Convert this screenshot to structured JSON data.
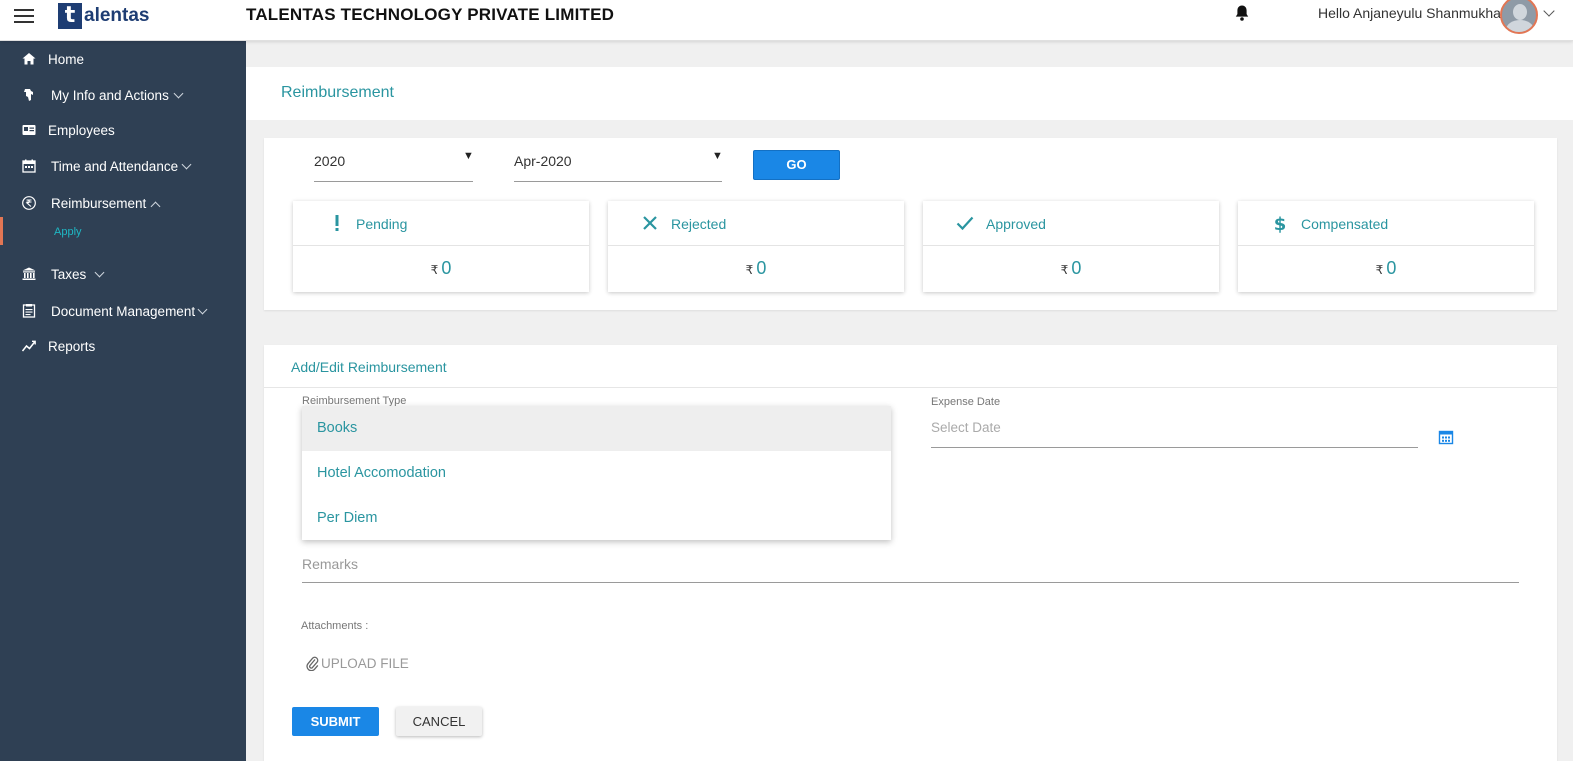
{
  "header": {
    "logo_letter": "t",
    "logo_text": "alentas",
    "company": "TALENTAS TECHNOLOGY PRIVATE LIMITED",
    "greeting": "Hello Anjaneyulu Shanmukha"
  },
  "sidebar": {
    "items": [
      {
        "label": "Home",
        "icon": "home-icon"
      },
      {
        "label": "My Info and Actions",
        "icon": "hand-icon"
      },
      {
        "label": "Employees",
        "icon": "id-card-icon"
      },
      {
        "label": "Time and Attendance",
        "icon": "calendar-icon"
      },
      {
        "label": "Reimbursement",
        "icon": "rupee-icon"
      },
      {
        "label": "Taxes",
        "icon": "bank-icon"
      },
      {
        "label": "Document Management",
        "icon": "document-icon"
      },
      {
        "label": "Reports",
        "icon": "chart-line-icon"
      }
    ],
    "sub_apply": "Apply",
    "active_color": "#e27654"
  },
  "page": {
    "title": "Reimbursement"
  },
  "filters": {
    "year": "2020",
    "month": "Apr-2020",
    "go_label": "GO"
  },
  "stats": [
    {
      "label": "Pending",
      "currency": "₹",
      "value": "0",
      "icon": "exclamation-icon"
    },
    {
      "label": "Rejected",
      "currency": "₹",
      "value": "0",
      "icon": "close-icon"
    },
    {
      "label": "Approved",
      "currency": "₹",
      "value": "0",
      "icon": "check-icon"
    },
    {
      "label": "Compensated",
      "currency": "₹",
      "value": "0",
      "icon": "dollar-icon"
    }
  ],
  "form": {
    "title": "Add/Edit Reimbursement",
    "type_label": "Reimbursement Type",
    "type_options": [
      "Books",
      "Hotel Accomodation",
      "Per Diem"
    ],
    "date_label": "Expense Date",
    "date_placeholder": "Select Date",
    "remarks_placeholder": "Remarks",
    "attachments_label": "Attachments :",
    "upload_label": "UPLOAD FILE",
    "submit_label": "SUBMIT",
    "cancel_label": "CANCEL"
  },
  "colors": {
    "accent": "#2a95a0",
    "primary_button": "#1a87e6",
    "sidebar_bg": "#2f4054"
  }
}
